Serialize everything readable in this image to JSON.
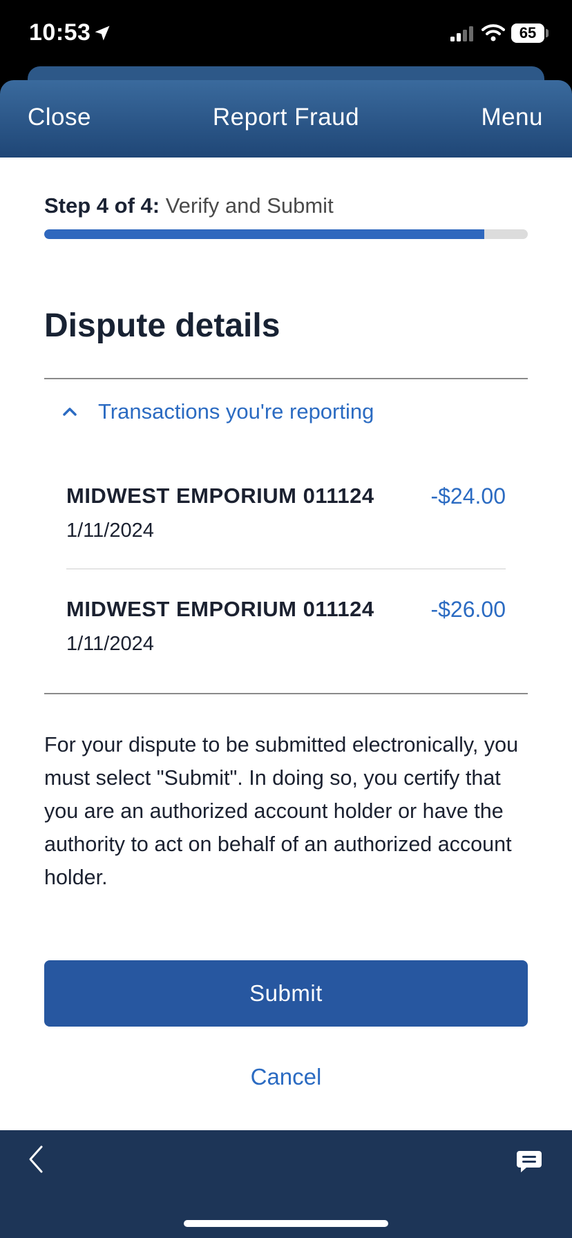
{
  "status_bar": {
    "time": "10:53",
    "battery": "65"
  },
  "header": {
    "close_label": "Close",
    "title": "Report Fraud",
    "menu_label": "Menu"
  },
  "step": {
    "label": "Step 4 of 4:",
    "name": "Verify and Submit",
    "progress_percent": 91
  },
  "section_title": "Dispute details",
  "accordion": {
    "label": "Transactions you're reporting",
    "expanded": true
  },
  "transactions": [
    {
      "merchant": "MIDWEST EMPORIUM 011124",
      "date": "1/11/2024",
      "amount": "-$24.00"
    },
    {
      "merchant": "MIDWEST EMPORIUM 011124",
      "date": "1/11/2024",
      "amount": "-$26.00"
    }
  ],
  "disclaimer": "For your dispute to be submitted electronically, you must select \"Submit\". In doing so, you certify that you are an authorized account holder or have the authority to act on behalf of an authorized account holder.",
  "actions": {
    "submit_label": "Submit",
    "cancel_label": "Cancel"
  },
  "colors": {
    "primary": "#2757a0",
    "link": "#2b6bc2",
    "header": "#1f4676",
    "bottom_bar": "#1d3557"
  },
  "icons": {
    "location": "location-arrow-icon",
    "signal": "cellular-signal-icon",
    "wifi": "wifi-icon",
    "accordion": "chevron-up-icon",
    "back": "chevron-left-icon",
    "chat": "chat-bubble-icon"
  }
}
